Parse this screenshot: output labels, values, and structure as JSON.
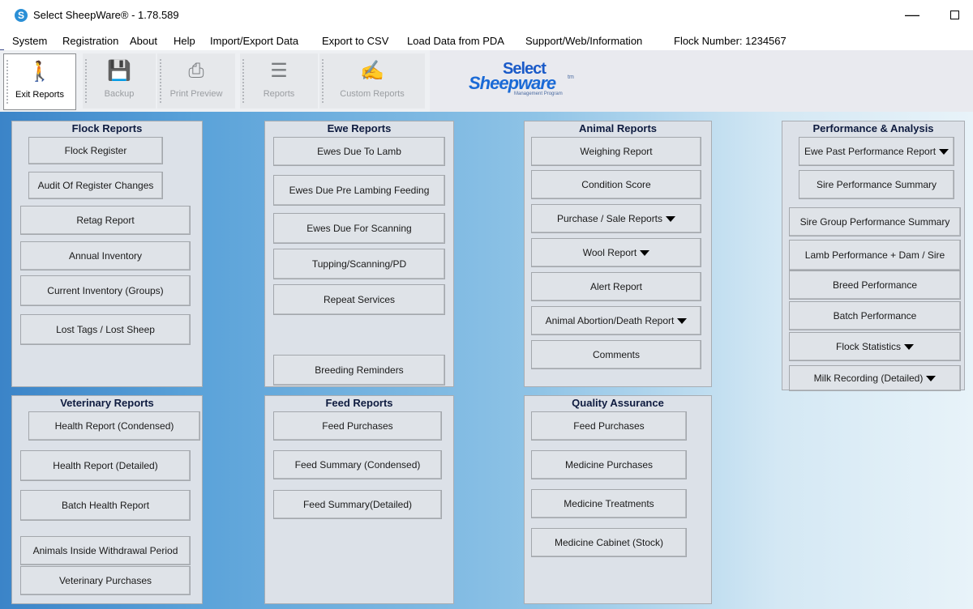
{
  "window": {
    "title": "Select SheepWare® - 1.78.589",
    "app_icon": "S",
    "minimize_glyph": "—"
  },
  "menu": [
    "System",
    "Registration",
    "About",
    "Help",
    "Import/Export Data",
    "Export to CSV",
    "Load Data from PDA",
    "Support/Web/Information",
    "Flock Number: 1234567"
  ],
  "toolbar": {
    "exit": {
      "label": "Exit Reports",
      "icon": "walking-person-icon"
    },
    "backup": {
      "label": "Backup",
      "icon": "floppy-disk-icon"
    },
    "print_preview": {
      "label": "Print Preview",
      "icon": "printer-icon"
    },
    "reports": {
      "label": "Reports",
      "icon": "document-icon"
    },
    "custom_reports": {
      "label": "Custom Reports",
      "icon": "document-edit-icon"
    }
  },
  "logo": {
    "line1": "Select",
    "line2": "Sheepware",
    "tm": "tm",
    "sub": "Management Program"
  },
  "flock": {
    "title": "Flock Reports",
    "items": [
      "Flock Register",
      "Audit Of Register Changes",
      "Retag Report",
      "Annual Inventory",
      "Current Inventory (Groups)",
      "Lost Tags / Lost Sheep"
    ]
  },
  "ewe": {
    "title": "Ewe Reports",
    "items": [
      "Ewes Due To Lamb",
      "Ewes Due Pre Lambing Feeding",
      "Ewes Due For Scanning",
      "Tupping/Scanning/PD",
      "Repeat Services",
      "Breeding Reminders"
    ]
  },
  "animal": {
    "title": "Animal Reports",
    "items": [
      "Weighing Report",
      "Condition Score",
      "Purchase / Sale Reports",
      "Wool Report",
      "Alert Report",
      "Animal Abortion/Death Report",
      "Comments"
    ]
  },
  "perf": {
    "title": "Performance & Analysis",
    "items": [
      "Ewe Past Performance Report",
      "Sire Performance Summary",
      "Sire Group Performance Summary",
      "Lamb Performance + Dam / Sire",
      "Breed Performance",
      "Batch Performance",
      "Flock Statistics",
      "Milk Recording (Detailed)"
    ]
  },
  "vet": {
    "title": "Veterinary Reports",
    "items": [
      "Health Report (Condensed)",
      "Health Report (Detailed)",
      "Batch Health Report",
      "Animals Inside Withdrawal Period",
      "Veterinary Purchases"
    ]
  },
  "feed": {
    "title": "Feed Reports",
    "items": [
      "Feed Purchases",
      "Feed Summary (Condensed)",
      "Feed Summary(Detailed)"
    ]
  },
  "qa": {
    "title": "Quality Assurance",
    "items": [
      "Feed Purchases",
      "Medicine Purchases",
      "Medicine Treatments",
      "Medicine Cabinet (Stock)"
    ]
  },
  "colors": {
    "content_gradient_start": "#3b84c8",
    "panel_bg": "#dce1e8",
    "panel_title": "#0e1b3f",
    "logo_blue": "#1a6ad6"
  }
}
